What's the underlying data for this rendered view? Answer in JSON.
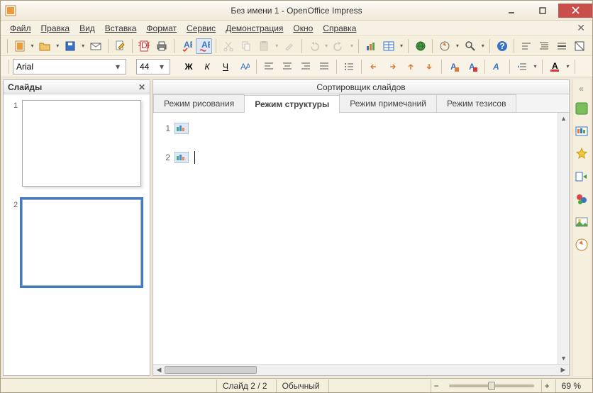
{
  "window": {
    "title": "Без имени 1 - OpenOffice Impress"
  },
  "menu": {
    "file": "Файл",
    "edit": "Правка",
    "view": "Вид",
    "insert": "Вставка",
    "format": "Формат",
    "tools": "Сервис",
    "slideshow": "Демонстрация",
    "window": "Окно",
    "help": "Справка"
  },
  "format_toolbar": {
    "font": "Arial",
    "size": "44"
  },
  "slides_panel": {
    "title": "Слайды",
    "items": [
      {
        "num": "1",
        "selected": false
      },
      {
        "num": "2",
        "selected": true
      }
    ]
  },
  "main_panel": {
    "title": "Сортировщик слайдов",
    "tabs": {
      "drawing": "Режим рисования",
      "outline": "Режим структуры",
      "notes": "Режим примечаний",
      "handout": "Режим тезисов"
    },
    "active_tab": "outline",
    "outline_rows": [
      {
        "num": "1"
      },
      {
        "num": "2"
      }
    ]
  },
  "statusbar": {
    "slide": "Слайд 2 / 2",
    "mode": "Обычный",
    "zoom": "69 %"
  }
}
